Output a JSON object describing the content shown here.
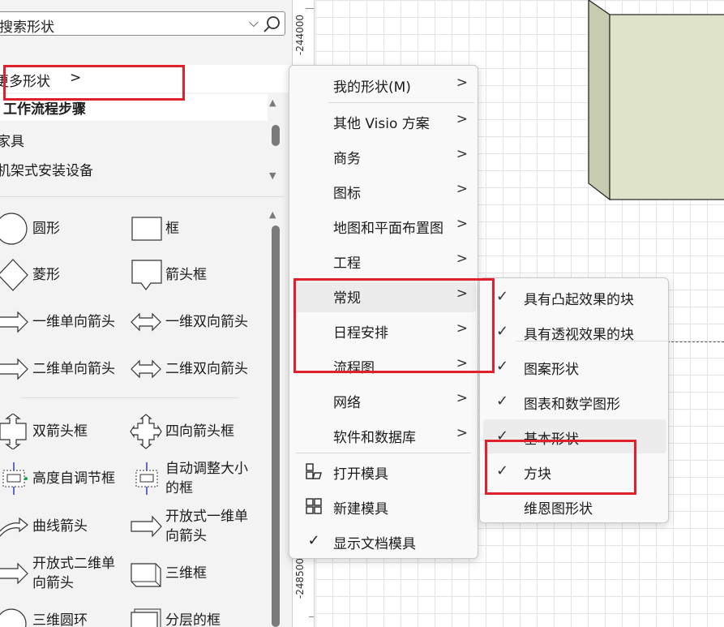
{
  "search": {
    "placeholder": "搜索形状"
  },
  "more_shapes": {
    "label": "更多形状",
    "arrow": ">"
  },
  "stencils": [
    {
      "label": "工作流程步骤",
      "active": true
    },
    {
      "label": "家具",
      "active": false
    },
    {
      "label": "机架式安装设备",
      "active": false
    }
  ],
  "shapes": [
    {
      "label": "圆形",
      "icon": "circle-icon"
    },
    {
      "label": "框",
      "icon": "box-icon"
    },
    {
      "label": "菱形",
      "icon": "diamond-icon"
    },
    {
      "label": "箭头框",
      "icon": "arrow-box-icon"
    },
    {
      "label": "一维单向箭头",
      "icon": "arrow-1d-single-icon"
    },
    {
      "label": "一维双向箭头",
      "icon": "arrow-1d-double-icon"
    },
    {
      "label": "二维单向箭头",
      "icon": "arrow-2d-single-icon"
    },
    {
      "label": "二维双向箭头",
      "icon": "arrow-2d-double-icon"
    },
    {
      "label": "双箭头框",
      "icon": "double-arrow-box-icon"
    },
    {
      "label": "四向箭头框",
      "icon": "four-way-arrow-box-icon"
    },
    {
      "label": "高度自调节框",
      "icon": "height-adjust-box-icon"
    },
    {
      "label": "自动调整大小的框",
      "icon": "auto-size-box-icon"
    },
    {
      "label": "曲线箭头",
      "icon": "curved-arrow-icon"
    },
    {
      "label": "开放式一维单向箭头",
      "icon": "open-1d-arrow-icon"
    },
    {
      "label": "开放式二维单向箭头",
      "icon": "open-2d-arrow-icon"
    },
    {
      "label": "三维框",
      "icon": "3d-box-icon"
    },
    {
      "label": "三维圆环",
      "icon": "3d-ring-icon"
    },
    {
      "label": "分层的框",
      "icon": "layered-box-icon"
    }
  ],
  "ruler": {
    "labels": [
      "-244000",
      "-248500"
    ]
  },
  "main_menu": {
    "items": [
      {
        "label": "我的形状(M)",
        "has_submenu": true
      },
      {
        "label": "其他 Visio 方案",
        "has_submenu": true
      },
      {
        "label": "商务",
        "has_submenu": true
      },
      {
        "label": "图标",
        "has_submenu": true
      },
      {
        "label": "地图和平面布置图",
        "has_submenu": true
      },
      {
        "label": "工程",
        "has_submenu": true
      },
      {
        "label": "常规",
        "has_submenu": true
      },
      {
        "label": "日程安排",
        "has_submenu": true
      },
      {
        "label": "流程图",
        "has_submenu": true
      },
      {
        "label": "网络",
        "has_submenu": true
      },
      {
        "label": "软件和数据库",
        "has_submenu": true
      },
      {
        "label": "打开模具",
        "icon": "open-stencil-icon"
      },
      {
        "label": "新建模具",
        "icon": "new-stencil-icon"
      },
      {
        "label": "显示文档模具",
        "icon": "check-icon"
      }
    ],
    "submenu_arrow": ">"
  },
  "sub_menu": {
    "check": "✓",
    "items": [
      {
        "label": "具有凸起效果的块",
        "checked": true
      },
      {
        "label": "具有透视效果的块",
        "checked": true
      },
      {
        "label": "图案形状",
        "checked": true
      },
      {
        "label": "图表和数学图形",
        "checked": true
      },
      {
        "label": "基本形状",
        "checked": true
      },
      {
        "label": "方块",
        "checked": true
      },
      {
        "label": "维恩图形状",
        "checked": false
      }
    ]
  },
  "colors": {
    "annotation_red": "#e0202a",
    "canvas_shape_fill": "#dfe3c9"
  }
}
